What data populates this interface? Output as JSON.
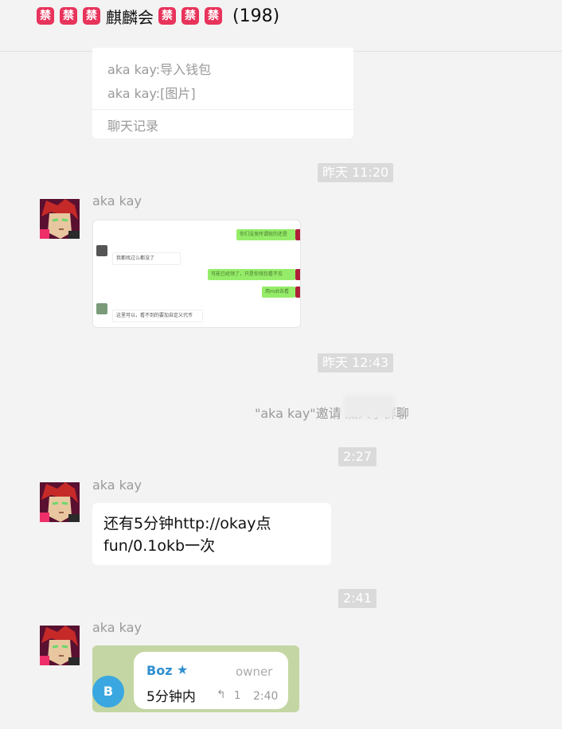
{
  "header": {
    "ban_glyph": "禁",
    "group_name": "麒麟会",
    "member_count": "(198)"
  },
  "forwarded_card": {
    "lines": [
      "aka kay:导入钱包",
      "aka kay:[图片]"
    ],
    "footer": "聊天记录"
  },
  "timestamps": [
    "昨天 11:20",
    "昨天 12:43",
    "2:27",
    "2:41"
  ],
  "sender_name": "aka kay",
  "messages": {
    "screenshot1": {
      "bubbles": [
        "你们没发所谓就的还是",
        "我都找过么都没了",
        "可能已经领了，只是你钱包看不见",
        "用mdt去看",
        "这里可以，看不到的要加自定义代币"
      ]
    },
    "system": "\"aka kay\"邀请        加入了群聊",
    "text": "还有5分钟http://okay点fun/0.1okb一次",
    "screenshot2": {
      "avatar_letter": "B",
      "name": "Boz",
      "star": "★",
      "role": "owner",
      "preview": "5分钟内",
      "reply_icon": "↰",
      "reply_count": "1",
      "time": "2:40"
    }
  },
  "colors": {
    "ban_badge": "#e8335b",
    "wechat_green": "#95ec69",
    "telegram_blue": "#3aa7e0"
  }
}
